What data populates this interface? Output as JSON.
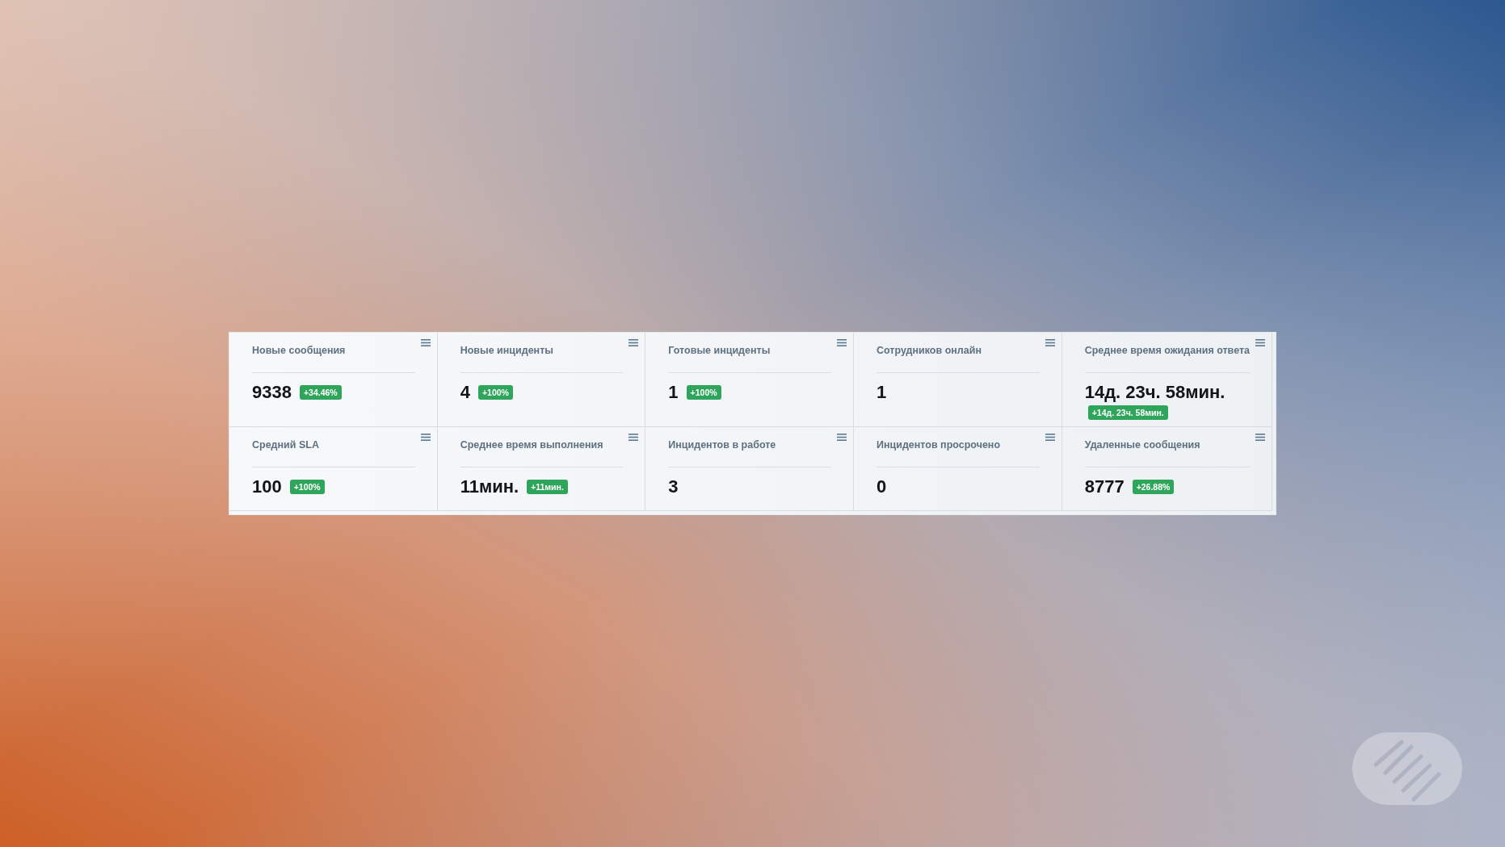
{
  "widgets": [
    {
      "title": "Новые сообщения",
      "value": "9338",
      "change": "+34.46%"
    },
    {
      "title": "Новые инциденты",
      "value": "4",
      "change": "+100%"
    },
    {
      "title": "Готовые инциденты",
      "value": "1",
      "change": "+100%"
    },
    {
      "title": "Сотрудников онлайн",
      "value": "1"
    },
    {
      "title": "Среднее время ожидания ответа",
      "value": "14д. 23ч. 58мин.",
      "change": "+14д. 23ч. 58мин."
    },
    {
      "title": "Средний SLA",
      "value": "100",
      "change": "+100%"
    },
    {
      "title": "Среднее время выполнения",
      "value": "11мин.",
      "change": "+11мин."
    },
    {
      "title": "Инцидентов в работе",
      "value": "3"
    },
    {
      "title": "Инцидентов просрочено",
      "value": "0"
    },
    {
      "title": "Удаленные сообщения",
      "value": "8777",
      "change": "+26.88%"
    }
  ]
}
